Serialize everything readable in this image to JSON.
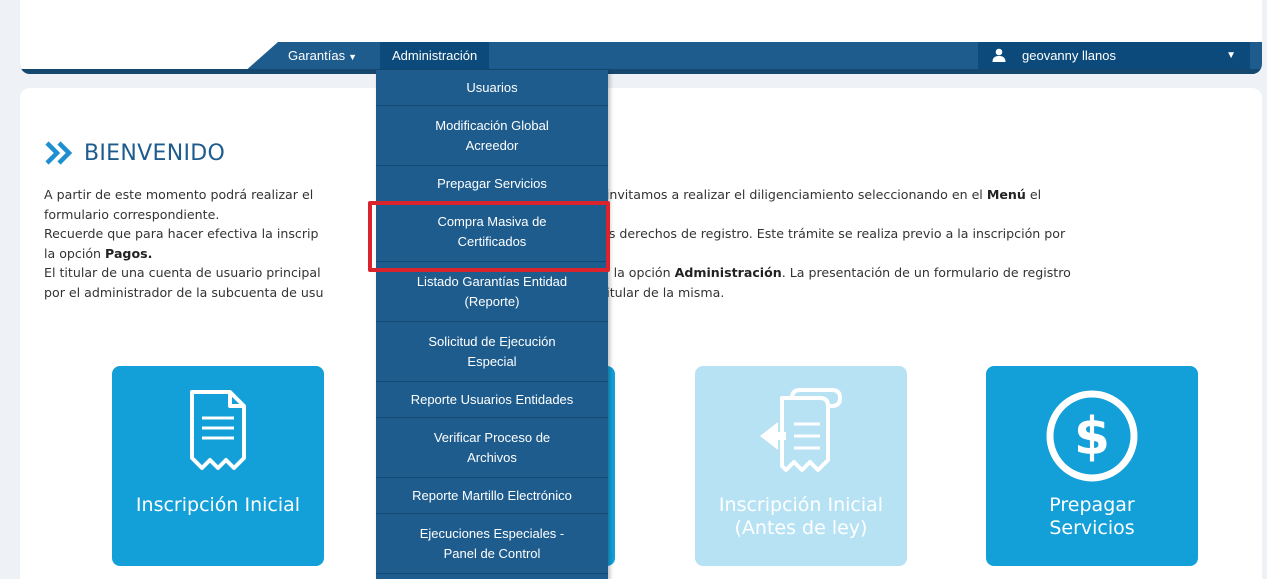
{
  "nav": {
    "garantias_label": "Garantías",
    "admin_label": "Administración",
    "user_name": "geovanny llanos"
  },
  "welcome": {
    "title": "BIENVENIDO"
  },
  "intro": {
    "p1_a": "A partir de este momento podrá realizar el ",
    "p1_b": "larios. Lo invitamos a realizar el diligenciamiento seleccionando en el ",
    "p1_bold": "Menú",
    "p1_c": " el",
    "p1_line2": "formulario correspondiente.",
    "p2_a": "Recuerde que para hacer efectiva la inscrip",
    "p2_b": "ago de los derechos de registro. Este trámite se realiza previo a la inscripción por",
    "p2_line2_a": "la opción ",
    "p2_line2_bold": "Pagos.",
    "p3_a": "El titular de una cuenta de usuario principal",
    "p3_b": "uario por la opción ",
    "p3_bold": "Administración",
    "p3_c": ". La presentación de un formulario de registro",
    "p3_line2_a": "por el administrador de la subcuenta de usu",
    "p3_line2_b": "a por el titular de la misma."
  },
  "tiles": [
    {
      "label_1": "Inscripción Inicial",
      "label_2": ""
    },
    {
      "label_1": "",
      "label_2": ""
    },
    {
      "label_1": "Inscripción Inicial",
      "label_2": "(Antes de ley)"
    },
    {
      "label_1": "Prepagar",
      "label_2": "Servicios"
    }
  ],
  "dropdown": {
    "items": [
      {
        "line1": "Usuarios",
        "line2": ""
      },
      {
        "line1": "Modificación Global",
        "line2": "Acreedor"
      },
      {
        "line1": "Prepagar Servicios",
        "line2": ""
      },
      {
        "line1": "Compra Masiva de",
        "line2": "Certificados"
      },
      {
        "line1": "Listado Garantías Entidad",
        "line2": "(Reporte)"
      },
      {
        "line1": "Solicitud de Ejecución",
        "line2": "Especial"
      },
      {
        "line1": "Reporte Usuarios Entidades",
        "line2": ""
      },
      {
        "line1": "Verificar Proceso de",
        "line2": "Archivos"
      },
      {
        "line1": "Reporte Martillo Electrónico",
        "line2": ""
      },
      {
        "line1": "Ejecuciones Especiales -",
        "line2": "Panel de Control"
      }
    ]
  },
  "colors": {
    "nav_blue": "#1e5c8e",
    "active_blue": "#0c4a7c",
    "tile_blue": "#139fd8",
    "tile_disabled": "#b7e2f4",
    "highlight_red": "#d9232d"
  }
}
